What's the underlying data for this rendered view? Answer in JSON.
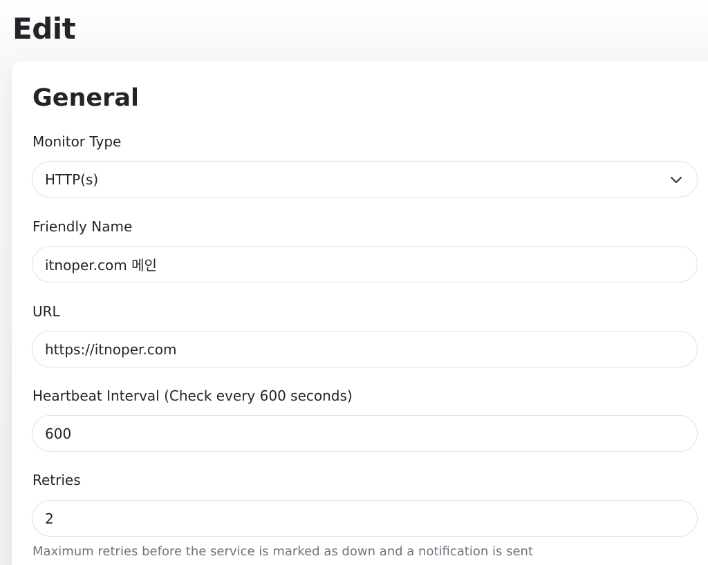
{
  "page": {
    "title": "Edit"
  },
  "general": {
    "section_title": "General",
    "monitor_type": {
      "label": "Monitor Type",
      "value": "HTTP(s)"
    },
    "friendly_name": {
      "label": "Friendly Name",
      "value": "itnoper.com 메인"
    },
    "url": {
      "label": "URL",
      "value": "https://itnoper.com"
    },
    "heartbeat": {
      "label": "Heartbeat Interval (Check every 600 seconds)",
      "value": "600"
    },
    "retries": {
      "label": "Retries",
      "value": "2",
      "help": "Maximum retries before the service is marked as down and a notification is sent"
    }
  },
  "icons": {
    "select_arrow": "chevron-down-icon"
  },
  "colors": {
    "text": "#212529",
    "muted": "#6c757d",
    "border": "#dee2e6",
    "card": "#ffffff"
  }
}
